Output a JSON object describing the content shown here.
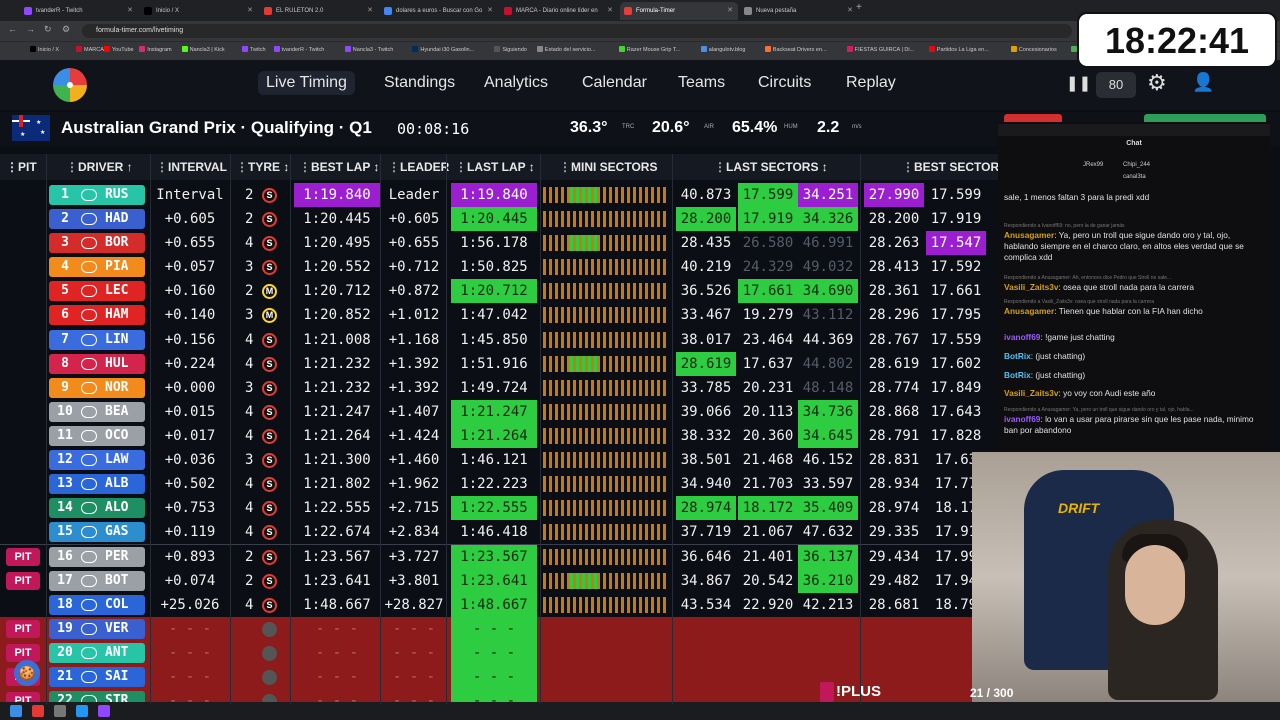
{
  "browser": {
    "tabs": [
      {
        "label": "tvanderR - Twitch",
        "color": "#9146ff"
      },
      {
        "label": "Inicio / X",
        "color": "#000000"
      },
      {
        "label": "EL RULETON 2.0",
        "color": "#e53935"
      },
      {
        "label": "dolares a euros - Buscar con Go",
        "color": "#4285f4"
      },
      {
        "label": "MARCA - Diario online líder en",
        "color": "#c8102e"
      },
      {
        "label": "Formula-Timer",
        "color": "#e63c3c"
      },
      {
        "label": "Nueva pestaña",
        "color": "#888888"
      }
    ],
    "active_tab": 5,
    "new_tab": "+",
    "url": "formula-timer.com/livetiming",
    "bookmarks": [
      "Inicio / X",
      "MARCA",
      "YouTube",
      "Instagram",
      "Nancla3 | Kick",
      "Twitch",
      "tvanderR - Twitch",
      "Nancla3 - Twitch",
      "Hyundai i30 Gasolin...",
      "Siguiendo",
      "Estado del servicio...",
      "Razer Mouse Grip T...",
      "alangulotv.blog",
      "Backseat Drivers en...",
      "FIESTAS GUIRCA | Di...",
      "Partidos La Liga en...",
      "Concesionarios",
      "dolares"
    ]
  },
  "nav": {
    "items": [
      "Live Timing",
      "Standings",
      "Analytics",
      "Calendar",
      "Teams",
      "Circuits",
      "Replay"
    ],
    "speed": "80",
    "pause_icon": "pause-icon"
  },
  "session": {
    "title": "Australian Grand Prix · Qualifying · Q1",
    "timer": "00:08:16",
    "track_temp": "36.3°",
    "track_label": "TRC",
    "air_temp": "20.6°",
    "air_label": "AIR",
    "humidity": "65.4%",
    "humidity_label": "HUM",
    "wind": "2.2",
    "wind_unit": "m/s"
  },
  "columns": [
    "PIT",
    "DRIVER ↑",
    "INTERVAL",
    "TYRE ↕",
    "BEST LAP ↕",
    "LEADER",
    "LAST LAP ↕",
    "MINI SECTORS",
    "LAST SECTORS ↕",
    "BEST SECTORS"
  ],
  "drivers": [
    {
      "pos": "1",
      "tla": "RUS",
      "color": "#27c4a8",
      "pit": "",
      "interval": "Interval",
      "laps": "2",
      "tyre": "S",
      "best": "1:19.840",
      "best_c": "p",
      "leader": "Leader",
      "last": "1:19.840",
      "last_c": "p",
      "ls": [
        "40.873",
        "17.599",
        "34.251"
      ],
      "ls_c": [
        "",
        "g",
        "p"
      ],
      "bs": [
        "27.990",
        "17.599"
      ],
      "bs_c": [
        "p",
        ""
      ],
      "ms": "g"
    },
    {
      "pos": "2",
      "tla": "HAD",
      "color": "#3a5fcf",
      "pit": "",
      "interval": "+0.605",
      "laps": "2",
      "tyre": "S",
      "best": "1:20.445",
      "best_c": "",
      "leader": "+0.605",
      "last": "1:20.445",
      "last_c": "g",
      "ls": [
        "28.200",
        "17.919",
        "34.326"
      ],
      "ls_c": [
        "g",
        "g",
        "g"
      ],
      "bs": [
        "28.200",
        "17.919"
      ],
      "bs_c": [
        "",
        ""
      ],
      "ms": ""
    },
    {
      "pos": "3",
      "tla": "BOR",
      "color": "#d42b2b",
      "pit": "",
      "interval": "+0.655",
      "laps": "4",
      "tyre": "S",
      "best": "1:20.495",
      "best_c": "",
      "leader": "+0.655",
      "last": "1:56.178",
      "last_c": "",
      "ls": [
        "28.435",
        "26.580",
        "46.991"
      ],
      "ls_c": [
        "",
        "d",
        "d"
      ],
      "bs": [
        "28.263",
        "17.547"
      ],
      "bs_c": [
        "",
        "p"
      ],
      "ms": "g"
    },
    {
      "pos": "4",
      "tla": "PIA",
      "color": "#f28a1c",
      "pit": "",
      "interval": "+0.057",
      "laps": "3",
      "tyre": "S",
      "best": "1:20.552",
      "best_c": "",
      "leader": "+0.712",
      "last": "1:50.825",
      "last_c": "",
      "ls": [
        "40.219",
        "24.329",
        "49.032"
      ],
      "ls_c": [
        "",
        "d",
        "d"
      ],
      "bs": [
        "28.413",
        "17.592"
      ],
      "bs_c": [
        "",
        ""
      ],
      "ms": ""
    },
    {
      "pos": "5",
      "tla": "LEC",
      "color": "#e02424",
      "pit": "",
      "interval": "+0.160",
      "laps": "2",
      "tyre": "M",
      "best": "1:20.712",
      "best_c": "",
      "leader": "+0.872",
      "last": "1:20.712",
      "last_c": "g",
      "ls": [
        "36.526",
        "17.661",
        "34.690"
      ],
      "ls_c": [
        "",
        "g",
        "g"
      ],
      "bs": [
        "28.361",
        "17.661"
      ],
      "bs_c": [
        "",
        ""
      ],
      "ms": ""
    },
    {
      "pos": "6",
      "tla": "HAM",
      "color": "#e02424",
      "pit": "",
      "interval": "+0.140",
      "laps": "3",
      "tyre": "M",
      "best": "1:20.852",
      "best_c": "",
      "leader": "+1.012",
      "last": "1:47.042",
      "last_c": "",
      "ls": [
        "33.467",
        "19.279",
        "43.112"
      ],
      "ls_c": [
        "",
        "",
        "d"
      ],
      "bs": [
        "28.296",
        "17.795"
      ],
      "bs_c": [
        "",
        ""
      ],
      "ms": ""
    },
    {
      "pos": "7",
      "tla": "LIN",
      "color": "#3a6ce0",
      "pit": "",
      "interval": "+0.156",
      "laps": "4",
      "tyre": "S",
      "best": "1:21.008",
      "best_c": "",
      "leader": "+1.168",
      "last": "1:45.850",
      "last_c": "",
      "ls": [
        "38.017",
        "23.464",
        "44.369"
      ],
      "ls_c": [
        "",
        "",
        ""
      ],
      "bs": [
        "28.767",
        "17.559"
      ],
      "bs_c": [
        "",
        ""
      ],
      "ms": ""
    },
    {
      "pos": "8",
      "tla": "HUL",
      "color": "#d4244b",
      "pit": "",
      "interval": "+0.224",
      "laps": "4",
      "tyre": "S",
      "best": "1:21.232",
      "best_c": "",
      "leader": "+1.392",
      "last": "1:51.916",
      "last_c": "",
      "ls": [
        "28.619",
        "17.637",
        "44.802"
      ],
      "ls_c": [
        "g",
        "",
        "d"
      ],
      "bs": [
        "28.619",
        "17.602"
      ],
      "bs_c": [
        "",
        ""
      ],
      "ms": "g"
    },
    {
      "pos": "9",
      "tla": "NOR",
      "color": "#f28a1c",
      "pit": "",
      "interval": "+0.000",
      "laps": "3",
      "tyre": "S",
      "best": "1:21.232",
      "best_c": "",
      "leader": "+1.392",
      "last": "1:49.724",
      "last_c": "",
      "ls": [
        "33.785",
        "20.231",
        "48.148"
      ],
      "ls_c": [
        "",
        "",
        "d"
      ],
      "bs": [
        "28.774",
        "17.849"
      ],
      "bs_c": [
        "",
        ""
      ],
      "ms": ""
    },
    {
      "pos": "10",
      "tla": "BEA",
      "color": "#9aa0a6",
      "pit": "",
      "interval": "+0.015",
      "laps": "4",
      "tyre": "S",
      "best": "1:21.247",
      "best_c": "",
      "leader": "+1.407",
      "last": "1:21.247",
      "last_c": "g",
      "ls": [
        "39.066",
        "20.113",
        "34.736"
      ],
      "ls_c": [
        "",
        "",
        "g"
      ],
      "bs": [
        "28.868",
        "17.643"
      ],
      "bs_c": [
        "",
        ""
      ],
      "ms": ""
    },
    {
      "pos": "11",
      "tla": "OCO",
      "color": "#9aa0a6",
      "pit": "",
      "interval": "+0.017",
      "laps": "4",
      "tyre": "S",
      "best": "1:21.264",
      "best_c": "",
      "leader": "+1.424",
      "last": "1:21.264",
      "last_c": "g",
      "ls": [
        "38.332",
        "20.360",
        "34.645"
      ],
      "ls_c": [
        "",
        "",
        "g"
      ],
      "bs": [
        "28.791",
        "17.828"
      ],
      "bs_c": [
        "",
        ""
      ],
      "ms": ""
    },
    {
      "pos": "12",
      "tla": "LAW",
      "color": "#3a6ce0",
      "pit": "",
      "interval": "+0.036",
      "laps": "3",
      "tyre": "S",
      "best": "1:21.300",
      "best_c": "",
      "leader": "+1.460",
      "last": "1:46.121",
      "last_c": "",
      "ls": [
        "38.501",
        "21.468",
        "46.152"
      ],
      "ls_c": [
        "",
        "",
        ""
      ],
      "bs": [
        "28.831",
        "17.63"
      ],
      "bs_c": [
        "",
        ""
      ],
      "ms": ""
    },
    {
      "pos": "13",
      "tla": "ALB",
      "color": "#2a66d8",
      "pit": "",
      "interval": "+0.502",
      "laps": "4",
      "tyre": "S",
      "best": "1:21.802",
      "best_c": "",
      "leader": "+1.962",
      "last": "1:22.223",
      "last_c": "",
      "ls": [
        "34.940",
        "21.703",
        "33.597"
      ],
      "ls_c": [
        "",
        "",
        ""
      ],
      "bs": [
        "28.934",
        "17.77"
      ],
      "bs_c": [
        "",
        ""
      ],
      "ms": ""
    },
    {
      "pos": "14",
      "tla": "ALO",
      "color": "#1e8f63",
      "pit": "",
      "interval": "+0.753",
      "laps": "4",
      "tyre": "S",
      "best": "1:22.555",
      "best_c": "",
      "leader": "+2.715",
      "last": "1:22.555",
      "last_c": "g",
      "ls": [
        "28.974",
        "18.172",
        "35.409"
      ],
      "ls_c": [
        "g",
        "g",
        "g"
      ],
      "bs": [
        "28.974",
        "18.17"
      ],
      "bs_c": [
        "",
        ""
      ],
      "ms": ""
    },
    {
      "pos": "15",
      "tla": "GAS",
      "color": "#2c8ecf",
      "pit": "",
      "interval": "+0.119",
      "laps": "4",
      "tyre": "S",
      "best": "1:22.674",
      "best_c": "",
      "leader": "+2.834",
      "last": "1:46.418",
      "last_c": "",
      "ls": [
        "37.719",
        "21.067",
        "47.632"
      ],
      "ls_c": [
        "",
        "",
        ""
      ],
      "bs": [
        "29.335",
        "17.91"
      ],
      "bs_c": [
        "",
        ""
      ],
      "ms": ""
    },
    {
      "pos": "16",
      "tla": "PER",
      "color": "#9aa0a6",
      "pit": "PIT",
      "interval": "+0.893",
      "laps": "2",
      "tyre": "S",
      "best": "1:23.567",
      "best_c": "",
      "leader": "+3.727",
      "last": "1:23.567",
      "last_c": "g",
      "ls": [
        "36.646",
        "21.401",
        "36.137"
      ],
      "ls_c": [
        "",
        "",
        "g"
      ],
      "bs": [
        "29.434",
        "17.99"
      ],
      "bs_c": [
        "",
        ""
      ],
      "ms": ""
    },
    {
      "pos": "17",
      "tla": "BOT",
      "color": "#9aa0a6",
      "pit": "PIT",
      "interval": "+0.074",
      "laps": "2",
      "tyre": "S",
      "best": "1:23.641",
      "best_c": "",
      "leader": "+3.801",
      "last": "1:23.641",
      "last_c": "g",
      "ls": [
        "34.867",
        "20.542",
        "36.210"
      ],
      "ls_c": [
        "",
        "",
        "g"
      ],
      "bs": [
        "29.482",
        "17.94"
      ],
      "bs_c": [
        "",
        ""
      ],
      "ms": "g"
    },
    {
      "pos": "18",
      "tla": "COL",
      "color": "#2a66d8",
      "pit": "",
      "interval": "+25.026",
      "laps": "4",
      "tyre": "S",
      "best": "1:48.667",
      "best_c": "",
      "leader": "+28.827",
      "last": "1:48.667",
      "last_c": "g",
      "ls": [
        "43.534",
        "22.920",
        "42.213"
      ],
      "ls_c": [
        "",
        "",
        ""
      ],
      "bs": [
        "28.681",
        "18.79"
      ],
      "bs_c": [
        "",
        ""
      ],
      "ms": ""
    },
    {
      "pos": "19",
      "tla": "VER",
      "color": "#3a5fcf",
      "pit": "PIT",
      "interval": "- - -",
      "laps": "",
      "tyre": "",
      "best": "- - -",
      "best_c": "",
      "leader": "- - -",
      "last": "- - -",
      "last_c": "g",
      "ls": [
        "",
        "",
        ""
      ],
      "ls_c": [
        "",
        "",
        ""
      ],
      "bs": [
        "",
        ""
      ],
      "bs_c": [
        "",
        ""
      ],
      "ms": "n",
      "out": true
    },
    {
      "pos": "20",
      "tla": "ANT",
      "color": "#27c4a8",
      "pit": "PIT",
      "interval": "- - -",
      "laps": "",
      "tyre": "",
      "best": "- - -",
      "best_c": "",
      "leader": "- - -",
      "last": "- - -",
      "last_c": "g",
      "ls": [
        "",
        "",
        ""
      ],
      "ls_c": [
        "",
        "",
        ""
      ],
      "bs": [
        "",
        ""
      ],
      "bs_c": [
        "",
        ""
      ],
      "ms": "n",
      "out": true
    },
    {
      "pos": "21",
      "tla": "SAI",
      "color": "#2a66d8",
      "pit": "PIT",
      "interval": "- - -",
      "laps": "",
      "tyre": "",
      "best": "- - -",
      "best_c": "",
      "leader": "- - -",
      "last": "- - -",
      "last_c": "g",
      "ls": [
        "",
        "",
        ""
      ],
      "ls_c": [
        "",
        "",
        ""
      ],
      "bs": [
        "",
        ""
      ],
      "bs_c": [
        "",
        ""
      ],
      "ms": "n",
      "out": true
    },
    {
      "pos": "22",
      "tla": "STR",
      "color": "#1e8f63",
      "pit": "PIT",
      "interval": "- - -",
      "laps": "",
      "tyre": "",
      "best": "- - -",
      "best_c": "",
      "leader": "- - -",
      "last": "- - -",
      "last_c": "g",
      "ls": [
        "",
        "",
        ""
      ],
      "ls_c": [
        "",
        "",
        ""
      ],
      "bs": [
        "",
        ""
      ],
      "bs_c": [
        "",
        ""
      ],
      "ms": "n",
      "out": true
    }
  ],
  "chat": {
    "title": "Chat",
    "header_users": [
      "JRex99",
      "Chipi_244",
      "canal3ta"
    ],
    "messages": [
      {
        "reply": "",
        "user": "",
        "text": "sale, 1 menos faltan 3 para la predi xdd",
        "cls": ""
      },
      {
        "reply": "Respondiendo a Ivanoff69: no, pero la de ganar jamás",
        "user": "Anusagamer",
        "text": "Ya, pero un troll que sigue dando oro y tal, ojo, hablando siempre en el charco claro, en altos eles verdad que se complica xdd",
        "cls": ""
      },
      {
        "reply": "Respondiendo a Anusagamer: Ah, entonces dice Pedro que Stroll no sale...",
        "user": "Vasili_Zaits3v",
        "text": "osea que stroll nada para la carrera",
        "cls": ""
      },
      {
        "reply": "Respondiendo a Vasili_Zaits3v: osea que stroll nada para la carrera",
        "user": "Anusagamer",
        "text": "Tienen que hablar con la FIA han dicho",
        "cls": ""
      },
      {
        "reply": "",
        "user": "ivanoff69",
        "text": "!game just chatting",
        "cls": "u2"
      },
      {
        "reply": "",
        "user": "BotRix",
        "text": "(just chatting)",
        "cls": "u3"
      },
      {
        "reply": "",
        "user": "BotRix",
        "text": "(just chatting)",
        "cls": "u3"
      },
      {
        "reply": "",
        "user": "Vasili_Zaits3v",
        "text": "yo voy con Audi este año",
        "cls": ""
      },
      {
        "reply": "Respondiendo a Anusagamer: Ya, pero un troll que sigue dando oro y tal, ojo, habla...",
        "user": "ivanoff69",
        "text": "lo van a usar para pirarse sin que les pase nada, minimo ban por abandono",
        "cls": "u2"
      }
    ]
  },
  "overlay": {
    "clock": "18:22:41",
    "plus_label": "!PLUS",
    "counter": "21 / 300",
    "chair_brand": "DRIFT"
  }
}
